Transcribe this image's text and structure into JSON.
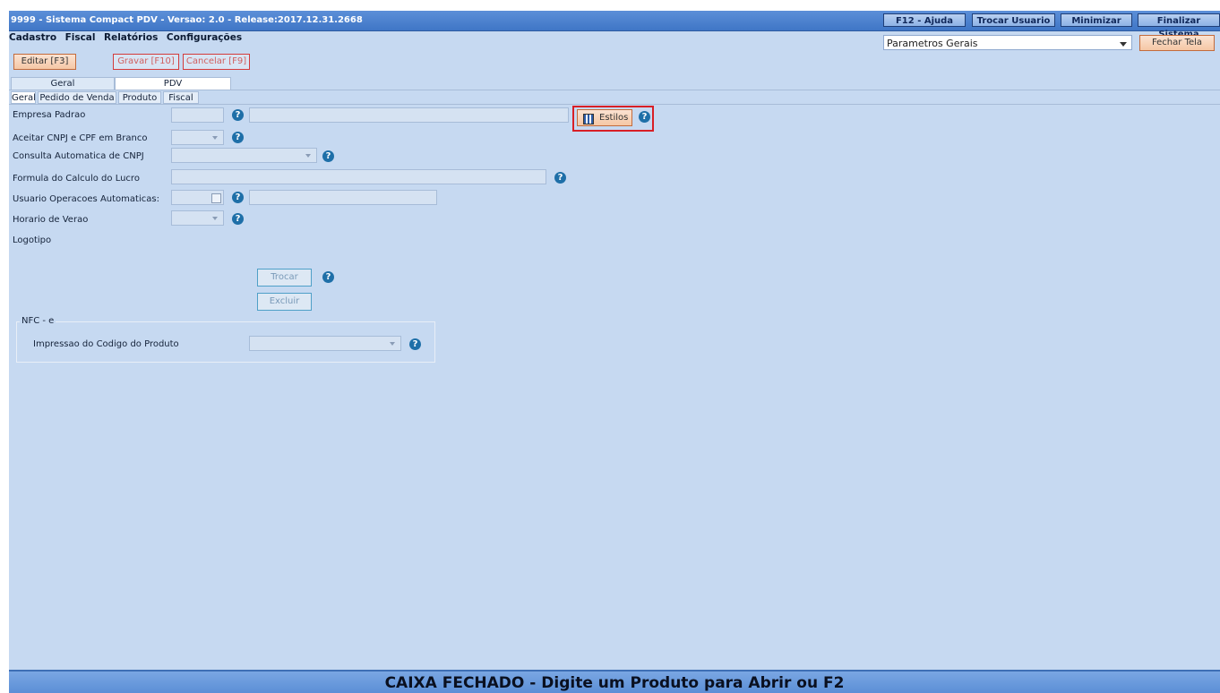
{
  "window": {
    "title": "9999 - Sistema Compact PDV - Versao: 2.0 - Release:2017.12.31.2668",
    "buttons": {
      "help": "F12 - Ajuda",
      "switch_user": "Trocar Usuario",
      "minimize": "Minimizar",
      "exit": "Finalizar Sistema"
    }
  },
  "menu": [
    "Cadastro",
    "Fiscal",
    "Relatórios",
    "Configurações"
  ],
  "screen_select": {
    "value": "Parametros Gerais"
  },
  "toolbar": {
    "edit": "Editar [F3]",
    "save": "Gravar [F10]",
    "cancel": "Cancelar [F9]",
    "close": "Fechar Tela"
  },
  "tabs_top": [
    "Geral",
    "PDV"
  ],
  "tabs_sub": [
    "Geral",
    "Pedido de Venda",
    "Produto",
    "Fiscal"
  ],
  "form": {
    "empresa_padrao": "Empresa Padrao",
    "estilos": "Estilos",
    "aceitar_cnpj": "Aceitar CNPJ e CPF em Branco",
    "consulta_cnpj": "Consulta Automatica de CNPJ",
    "formula_lucro": "Formula do Calculo do Lucro",
    "usuario_operacoes": "Usuario Operacoes Automaticas:",
    "horario_verao": "Horario de Verao",
    "logotipo": "Logotipo",
    "trocar": "Trocar",
    "excluir": "Excluir"
  },
  "nfce": {
    "title": "NFC - e",
    "impressao_codigo": "Impressao do Codigo do Produto"
  },
  "status": "CAIXA FECHADO - Digite um Produto para Abrir ou F2",
  "colors": {
    "background": "#c6d9f1",
    "titlebar": "#3f76c6",
    "highlight": "#d81f26",
    "help_icon": "#1e6fa8"
  }
}
